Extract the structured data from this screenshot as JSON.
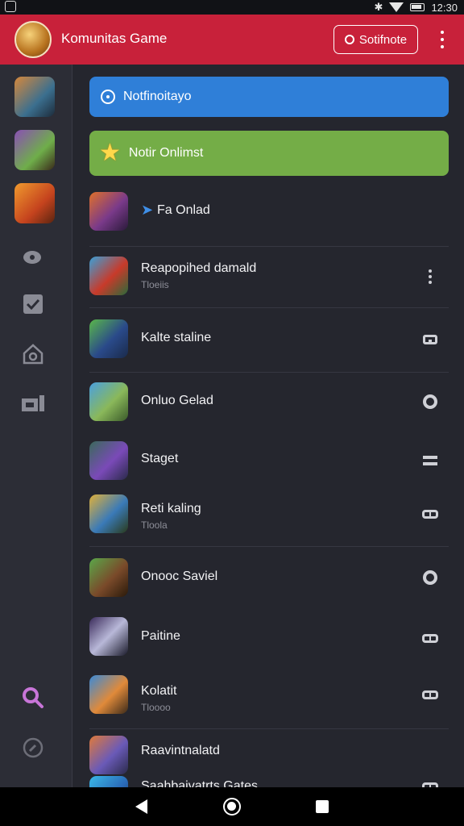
{
  "status_bar": {
    "time": "12:30"
  },
  "app_bar": {
    "title": "Komunitas Game",
    "action_label": "Sotifnote"
  },
  "banners": {
    "blue_text": "Notfinoitayo",
    "green_text": "Notir Onlimst"
  },
  "list": [
    {
      "name": "Fa Onlad",
      "sub": "",
      "action_icon": ""
    },
    {
      "name": "Reapopihed damald",
      "sub": "Tloeiis",
      "action_icon": "more-vertical-icon"
    },
    {
      "name": "Kalte staline",
      "sub": "",
      "action_icon": "controller-icon"
    },
    {
      "name": "Onluo Gelad",
      "sub": "",
      "action_icon": "record-icon"
    },
    {
      "name": "Staget",
      "sub": "",
      "action_icon": "menu-icon"
    },
    {
      "name": "Reti kaling",
      "sub": "Tloola",
      "action_icon": "link-icon"
    },
    {
      "name": "Onooc Saviel",
      "sub": "",
      "action_icon": "record-icon"
    },
    {
      "name": "Paitine",
      "sub": "",
      "action_icon": "link-icon"
    },
    {
      "name": "Kolatit",
      "sub": "Tloooo",
      "action_icon": "link-icon"
    },
    {
      "name": "Raavintnalatd",
      "sub": "",
      "action_icon": ""
    },
    {
      "name": "Saahbaivatrts Gates",
      "sub": "",
      "action_icon": "link-icon"
    }
  ],
  "colors": {
    "app_bar": "#c8213a",
    "background": "#25262e",
    "rail": "#2c2d36",
    "banner_blue": "#2f7fd8",
    "banner_green": "#74ad47",
    "search_accent": "#c875d8"
  }
}
